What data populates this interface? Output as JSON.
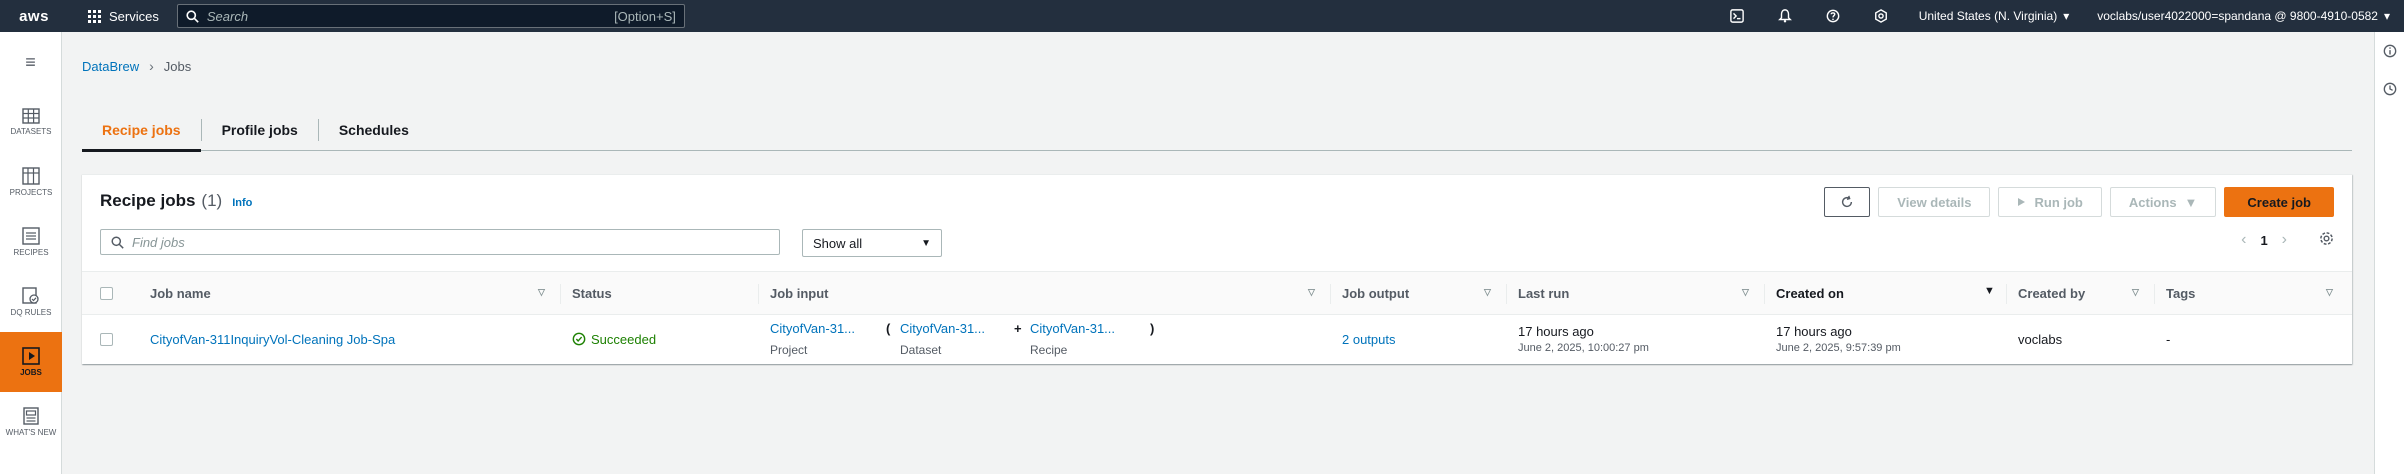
{
  "topnav": {
    "logo": "aws",
    "services_label": "Services",
    "search_placeholder": "Search",
    "search_shortcut": "[Option+S]",
    "region": "United States (N. Virginia)",
    "account": "voclabs/user4022000=spandana @ 9800-4910-0582",
    "icons": [
      "cloudshell-icon",
      "bell-icon",
      "help-icon",
      "settings-icon"
    ]
  },
  "leftrail": {
    "items": [
      {
        "label": "DATASETS",
        "icon": "table-icon",
        "active": false
      },
      {
        "label": "PROJECTS",
        "icon": "grid-icon",
        "active": false
      },
      {
        "label": "RECIPES",
        "icon": "list-icon",
        "active": false
      },
      {
        "label": "DQ RULES",
        "icon": "ruleset-icon",
        "active": false
      },
      {
        "label": "JOBS",
        "icon": "play-icon",
        "active": true
      },
      {
        "label": "WHAT'S NEW",
        "icon": "newspaper-icon",
        "active": false
      }
    ]
  },
  "breadcrumb": {
    "root": "DataBrew",
    "current": "Jobs"
  },
  "tabs": [
    {
      "label": "Recipe jobs",
      "active": true
    },
    {
      "label": "Profile jobs",
      "active": false
    },
    {
      "label": "Schedules",
      "active": false
    }
  ],
  "container": {
    "title": "Recipe jobs",
    "count": "(1)",
    "info": "Info",
    "buttons": {
      "view_details": "View details",
      "run_job": "Run job",
      "actions": "Actions",
      "create_job": "Create job"
    },
    "filter_placeholder": "Find jobs",
    "select_value": "Show all",
    "page": "1"
  },
  "table": {
    "columns": {
      "job_name": "Job name",
      "status": "Status",
      "job_input": "Job input",
      "job_output": "Job output",
      "last_run": "Last run",
      "created_on": "Created on",
      "created_by": "Created by",
      "tags": "Tags"
    },
    "rows": [
      {
        "job_name": "CityofVan-311InquiryVol-Cleaning Job-Spa",
        "status": "Succeeded",
        "input_project": "CityofVan-31...",
        "input_project_label": "Project",
        "input_dataset": "CityofVan-31...",
        "input_dataset_label": "Dataset",
        "input_recipe": "CityofVan-31...",
        "input_recipe_label": "Recipe",
        "open_paren": "(",
        "plus": "+",
        "close_paren": ")",
        "job_output": "2 outputs",
        "last_run": "17 hours ago",
        "last_run_date": "June 2, 2025, 10:00:27 pm",
        "created_on": "17 hours ago",
        "created_on_date": "June 2, 2025, 9:57:39 pm",
        "created_by": "voclabs",
        "tags": "-"
      }
    ]
  },
  "colors": {
    "nav_bg": "#232f3e",
    "accent": "#ec7211",
    "link": "#0073bb",
    "success": "#1d8102"
  }
}
